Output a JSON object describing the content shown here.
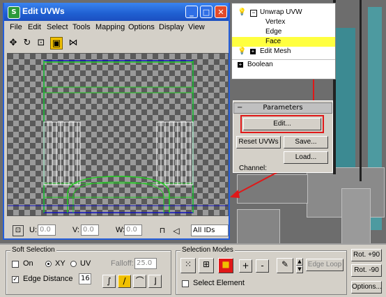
{
  "uvw_window": {
    "title": "Edit UVWs",
    "menu": [
      "File",
      "Edit",
      "Select",
      "Tools",
      "Mapping",
      "Options",
      "Display",
      "View"
    ],
    "statusbar": {
      "u_label": "U:",
      "u_value": "0.0",
      "v_label": "V:",
      "v_value": "0.0",
      "w_label": "W:",
      "w_value": "0.0",
      "ids_value": "All IDs"
    }
  },
  "modifier_stack": {
    "items": [
      {
        "label": "Unwrap UVW"
      },
      {
        "label": "Vertex"
      },
      {
        "label": "Edge"
      },
      {
        "label": "Face"
      },
      {
        "label": "Edit Mesh"
      },
      {
        "label": "Boolean"
      }
    ]
  },
  "parameters": {
    "title": "Parameters",
    "edit_label": "Edit...",
    "reset_label": "Reset UVWs",
    "save_label": "Save...",
    "load_label": "Load...",
    "channel_label": "Channel:"
  },
  "soft_selection": {
    "title": "Soft Selection",
    "on_label": "On",
    "on_checked": false,
    "xy_label": "XY",
    "uv_label": "UV",
    "falloff_label": "Falloff:",
    "falloff_value": "25.0",
    "edge_distance_label": "Edge Distance",
    "edge_distance_checked": true,
    "edge_distance_value": "16"
  },
  "selection_modes": {
    "title": "Selection Modes",
    "plus_label": "+",
    "minus_label": "-",
    "edge_loop_label": "Edge Loop",
    "select_element_label": "Select Element",
    "select_element_checked": false
  },
  "right_buttons": {
    "rot_plus": "Rot. +90",
    "rot_minus": "Rot. -90",
    "options": "Options..."
  },
  "colors": {
    "title_bar": "#245edb",
    "highlight": "#ffff40",
    "annotation_red": "#e01818",
    "uv_green": "#22cc22",
    "uv_blue": "#1010c0",
    "active_tool": "#f0c000"
  }
}
